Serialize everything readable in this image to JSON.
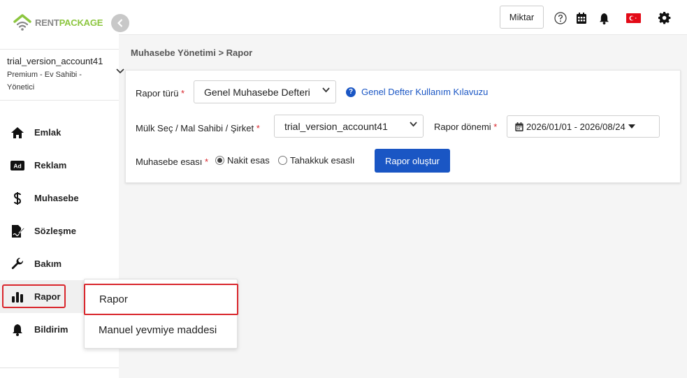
{
  "brand": {
    "part1": "RENT",
    "part2": "PACKAGE",
    "green": "#8cc63f"
  },
  "account": {
    "name": "trial_version_account41",
    "role": "Premium - Ev Sahibi - Yönetici"
  },
  "sidebar": {
    "items": [
      {
        "label": "Emlak",
        "icon": "home-icon"
      },
      {
        "label": "Reklam",
        "icon": "ad-icon"
      },
      {
        "label": "Muhasebe",
        "icon": "dollar-icon"
      },
      {
        "label": "Sözleşme",
        "icon": "contract-icon"
      },
      {
        "label": "Bakım",
        "icon": "wrench-icon"
      },
      {
        "label": "Rapor",
        "icon": "chart-icon",
        "active": true
      },
      {
        "label": "Bildirim",
        "icon": "bell-icon"
      }
    ]
  },
  "header": {
    "miktar_label": "Miktar",
    "icons": [
      "help-icon",
      "calendar-icon",
      "bell-icon",
      "flag-tr-icon",
      "gear-icon"
    ]
  },
  "breadcrumb": "Muhasebe Yönetimi > Rapor",
  "form": {
    "report_type_label": "Rapor türü",
    "report_type_value": "Genel Muhasebe Defteri",
    "help_link": "Genel Defter Kullanım Kılavuzu",
    "property_label": "Mülk Seç / Mal Sahibi / Şirket",
    "property_value": "trial_version_account41",
    "period_label": "Rapor dönemi",
    "period_value": "2026/01/01 - 2026/08/24",
    "basis_label": "Muhasebe esası",
    "basis_options": [
      "Nakit esas",
      "Tahakkuk esaslı"
    ],
    "basis_selected": "Nakit esas",
    "submit_label": "Rapor oluştur",
    "required_mark": "*"
  },
  "submenu": {
    "items": [
      "Rapor",
      "Manuel yevmiye maddesi"
    ]
  },
  "colors": {
    "primary": "#1a56c4",
    "required": "#d9262c",
    "highlight": "#d9262c"
  }
}
